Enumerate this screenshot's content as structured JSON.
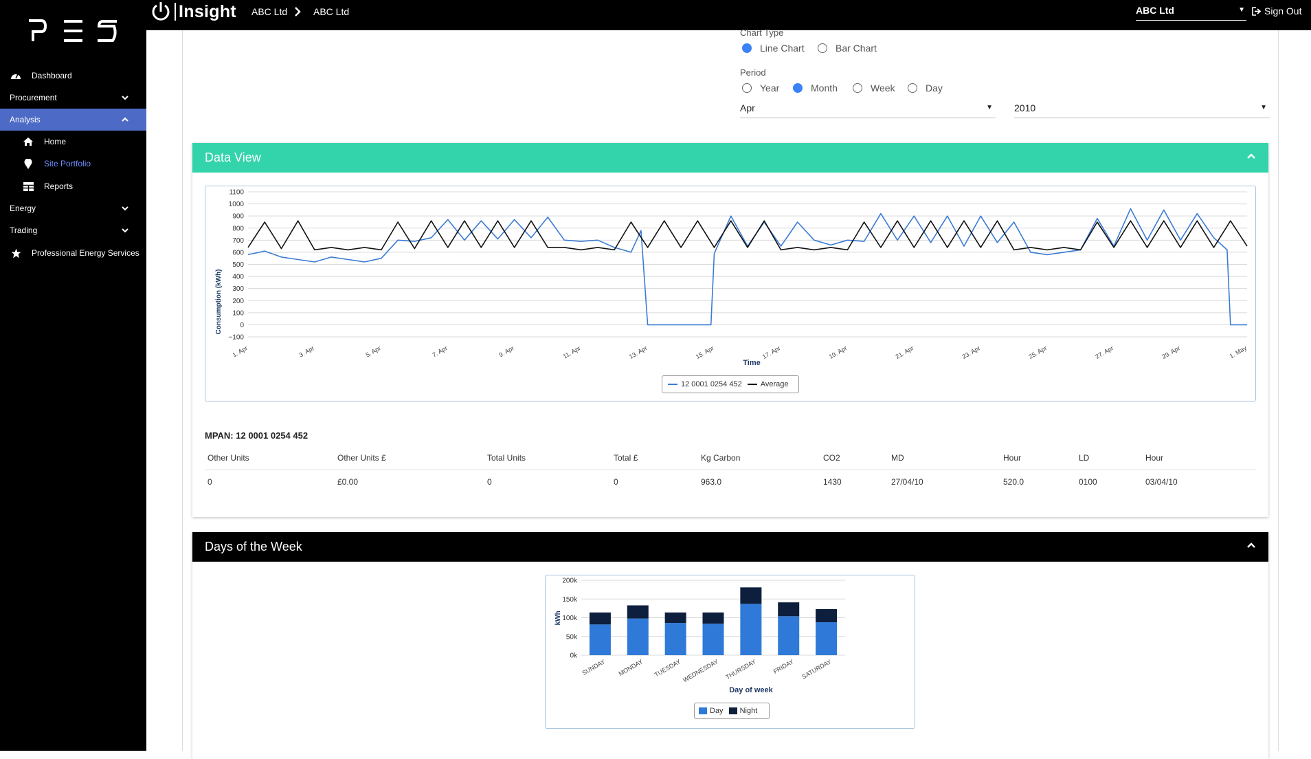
{
  "sidebar": {
    "items": [
      {
        "label": "Dashboard",
        "icon": "dashboard-icon"
      },
      {
        "label": "Procurement"
      },
      {
        "label": "Analysis"
      },
      {
        "label": "Home",
        "icon": "home-icon"
      },
      {
        "label": "Site Portfolio",
        "icon": "map-pin-icon"
      },
      {
        "label": "Reports",
        "icon": "table-icon"
      },
      {
        "label": "Energy"
      },
      {
        "label": "Trading"
      },
      {
        "label": "Professional Energy Services",
        "icon": "star-icon"
      }
    ]
  },
  "topbar": {
    "brand": "Insight",
    "crumb1": "ABC Ltd",
    "crumb2": "ABC Ltd",
    "account": "ABC Ltd",
    "signout": "Sign Out"
  },
  "controls": {
    "chart_type_label": "Chart Type",
    "chart_type_options": [
      "Line Chart",
      "Bar Chart"
    ],
    "chart_type_selected": "Line Chart",
    "period_label": "Period",
    "period_options": [
      "Year",
      "Month",
      "Week",
      "Day"
    ],
    "period_selected": "Month",
    "month_value": "Apr",
    "year_value": "2010"
  },
  "data_view": {
    "title": "Data View",
    "mpan": "MPAN: 12 0001 0254 452",
    "columns": [
      "Other Units",
      "Other Units £",
      "Total Units",
      "Total £",
      "Kg Carbon",
      "CO2",
      "MD",
      "Hour",
      "LD",
      "Hour"
    ],
    "values": [
      "0",
      "£0.00",
      "0",
      "0",
      "963.0",
      "1430",
      "27/04/10",
      "520.0",
      "0100",
      "03/04/10"
    ]
  },
  "days_of_week": {
    "title": "Days of the Week"
  },
  "colors": {
    "sidebar_bg": "#000000",
    "active_nav": "#4d6bc6",
    "data_view_header": "#33d4ab",
    "days_header": "#000000",
    "series_blue": "#3a7bd5",
    "series_black": "#111111",
    "bar_night": "#0d1f3c"
  },
  "chart_data": [
    {
      "type": "line",
      "xlabel": "Time",
      "ylabel": "Consumption (kWh)",
      "ylim": [
        -100,
        1100
      ],
      "yticks": [
        1100,
        1000,
        900,
        800,
        700,
        600,
        500,
        400,
        300,
        200,
        100,
        0,
        -100
      ],
      "xticks": [
        "1. Apr",
        "3. Apr",
        "5. Apr",
        "7. Apr",
        "9. Apr",
        "11. Apr",
        "13. Apr",
        "15. Apr",
        "17. Apr",
        "19. Apr",
        "21. Apr",
        "23. Apr",
        "25. Apr",
        "27. Apr",
        "29. Apr",
        "1. May"
      ],
      "legend": "bottom-center",
      "series": [
        {
          "name": "12 0001 0254 452",
          "color": "#3a7bd5",
          "x": [
            1,
            1.5,
            2,
            2.5,
            3,
            3.5,
            4,
            4.5,
            5,
            5.5,
            6,
            6.5,
            7,
            7.5,
            8,
            8.5,
            9,
            9.5,
            10,
            10.5,
            11,
            11.5,
            12,
            12.5,
            12.8,
            13,
            13.5,
            14,
            14.5,
            14.9,
            15,
            15.5,
            16,
            16.5,
            17,
            17.5,
            18,
            18.5,
            19,
            19.5,
            20,
            20.5,
            21,
            21.5,
            22,
            22.5,
            23,
            23.5,
            24,
            24.5,
            25,
            25.5,
            26,
            26.5,
            27,
            27.5,
            28,
            28.5,
            29,
            29.5,
            30,
            30.4,
            30.5,
            31
          ],
          "y": [
            580,
            610,
            560,
            540,
            520,
            560,
            540,
            520,
            550,
            700,
            690,
            720,
            870,
            700,
            860,
            710,
            870,
            720,
            890,
            700,
            690,
            700,
            640,
            600,
            780,
            0,
            0,
            0,
            0,
            0,
            590,
            900,
            650,
            850,
            650,
            850,
            700,
            660,
            700,
            690,
            920,
            700,
            900,
            680,
            900,
            650,
            900,
            680,
            850,
            600,
            580,
            600,
            620,
            880,
            650,
            960,
            700,
            950,
            700,
            920,
            720,
            620,
            0,
            0
          ]
        },
        {
          "name": "Average",
          "color": "#111111",
          "x": [
            1,
            1.5,
            2,
            2.5,
            3,
            3.5,
            4,
            4.5,
            5,
            5.5,
            6,
            6.5,
            7,
            7.5,
            8,
            8.5,
            9,
            9.5,
            10,
            10.5,
            11,
            11.5,
            12,
            12.5,
            13,
            13.5,
            14,
            14.5,
            15,
            15.5,
            16,
            16.5,
            17,
            17.5,
            18,
            18.5,
            19,
            19.5,
            20,
            20.5,
            21,
            21.5,
            22,
            22.5,
            23,
            23.5,
            24,
            24.5,
            25,
            25.5,
            26,
            26.5,
            27,
            27.5,
            28,
            28.5,
            29,
            29.5,
            30,
            30.5,
            31
          ],
          "y": [
            640,
            850,
            630,
            860,
            620,
            640,
            620,
            640,
            620,
            850,
            630,
            860,
            640,
            860,
            640,
            860,
            640,
            860,
            640,
            640,
            620,
            640,
            620,
            850,
            640,
            860,
            640,
            860,
            640,
            860,
            640,
            860,
            620,
            640,
            620,
            640,
            620,
            850,
            640,
            860,
            640,
            860,
            640,
            860,
            640,
            860,
            620,
            640,
            620,
            640,
            620,
            850,
            640,
            860,
            640,
            860,
            640,
            860,
            640,
            860,
            650
          ]
        }
      ]
    },
    {
      "type": "bar",
      "stacked": true,
      "xlabel": "Day of week",
      "ylabel": "kWh",
      "ylim": [
        0,
        200000
      ],
      "yticks": [
        "200k",
        "150k",
        "100k",
        "50k",
        "0k"
      ],
      "categories": [
        "SUNDAY",
        "MONDAY",
        "TUESDAY",
        "WEDNESDAY",
        "THURSDAY",
        "FRIDAY",
        "SATURDAY"
      ],
      "legend": "bottom-center",
      "series": [
        {
          "name": "Day",
          "color": "#2f7ad8",
          "values": [
            82000,
            98000,
            86000,
            84000,
            137000,
            104000,
            88000
          ]
        },
        {
          "name": "Night",
          "color": "#0d1f3c",
          "values": [
            32000,
            35000,
            28000,
            30000,
            44000,
            37000,
            35000
          ]
        }
      ]
    }
  ]
}
